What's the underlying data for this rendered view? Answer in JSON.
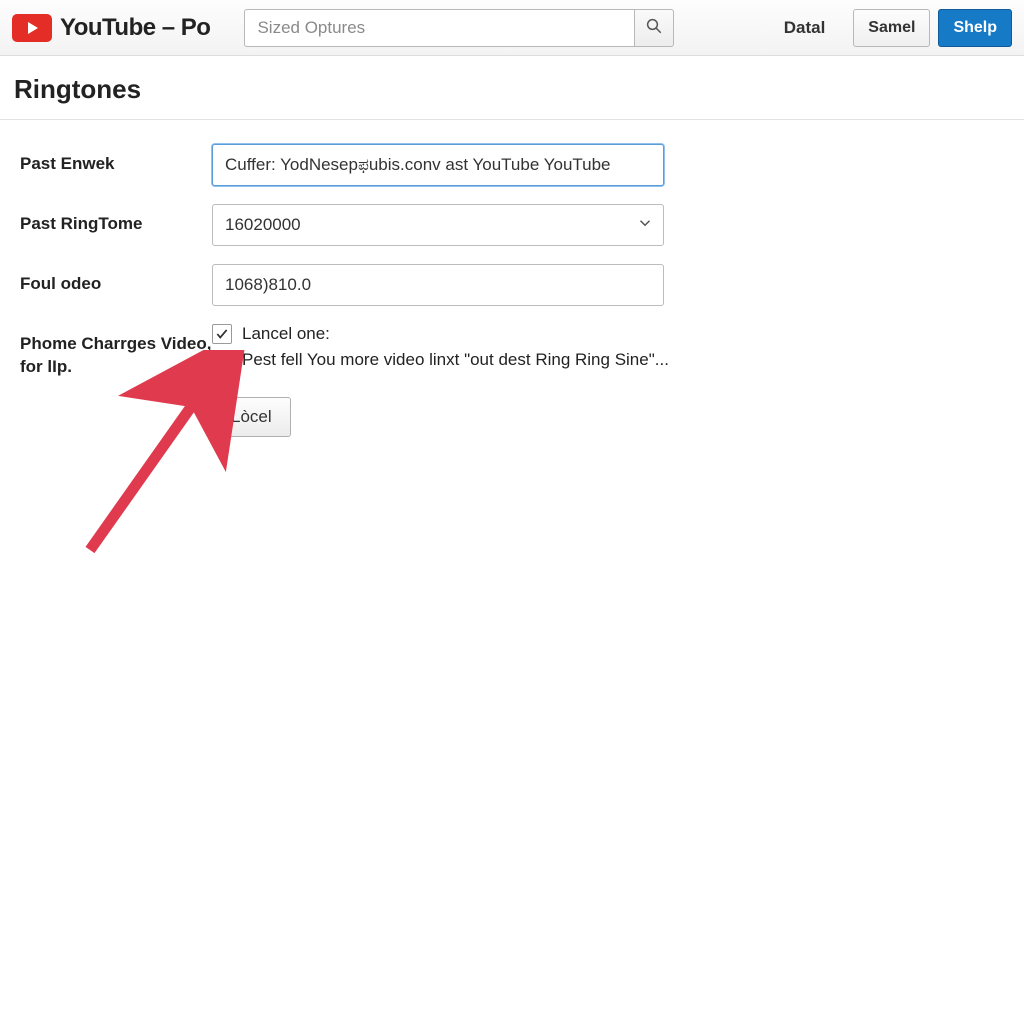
{
  "header": {
    "brand": "YouTube – Po",
    "search_placeholder": "Sized Optures",
    "link_datal": "Datal",
    "btn_samel": "Samel",
    "btn_shelp": "Shelp"
  },
  "page": {
    "title": "Ringtones"
  },
  "form": {
    "past_enwek": {
      "label": "Past Enwek",
      "value": "Cuffer: YodNesepಫubis.conv ast YouTube YouTube"
    },
    "past_ringtome": {
      "label": "Past RingTome",
      "value": "16020000"
    },
    "foul_odeo": {
      "label": "Foul odeo",
      "value": "1068)810.0"
    },
    "phome_charrges": {
      "label": "Phome Charrges Video, for lIp.",
      "opt1": "Lancel one:",
      "opt2": "Pest fell You more video linxt \"out dest Ring Ring Sine\"..."
    },
    "submit_label": "Lòcel"
  },
  "colors": {
    "brand_red": "#e52d27",
    "primary_blue": "#167ac6",
    "arrow": "#e03a4e"
  }
}
